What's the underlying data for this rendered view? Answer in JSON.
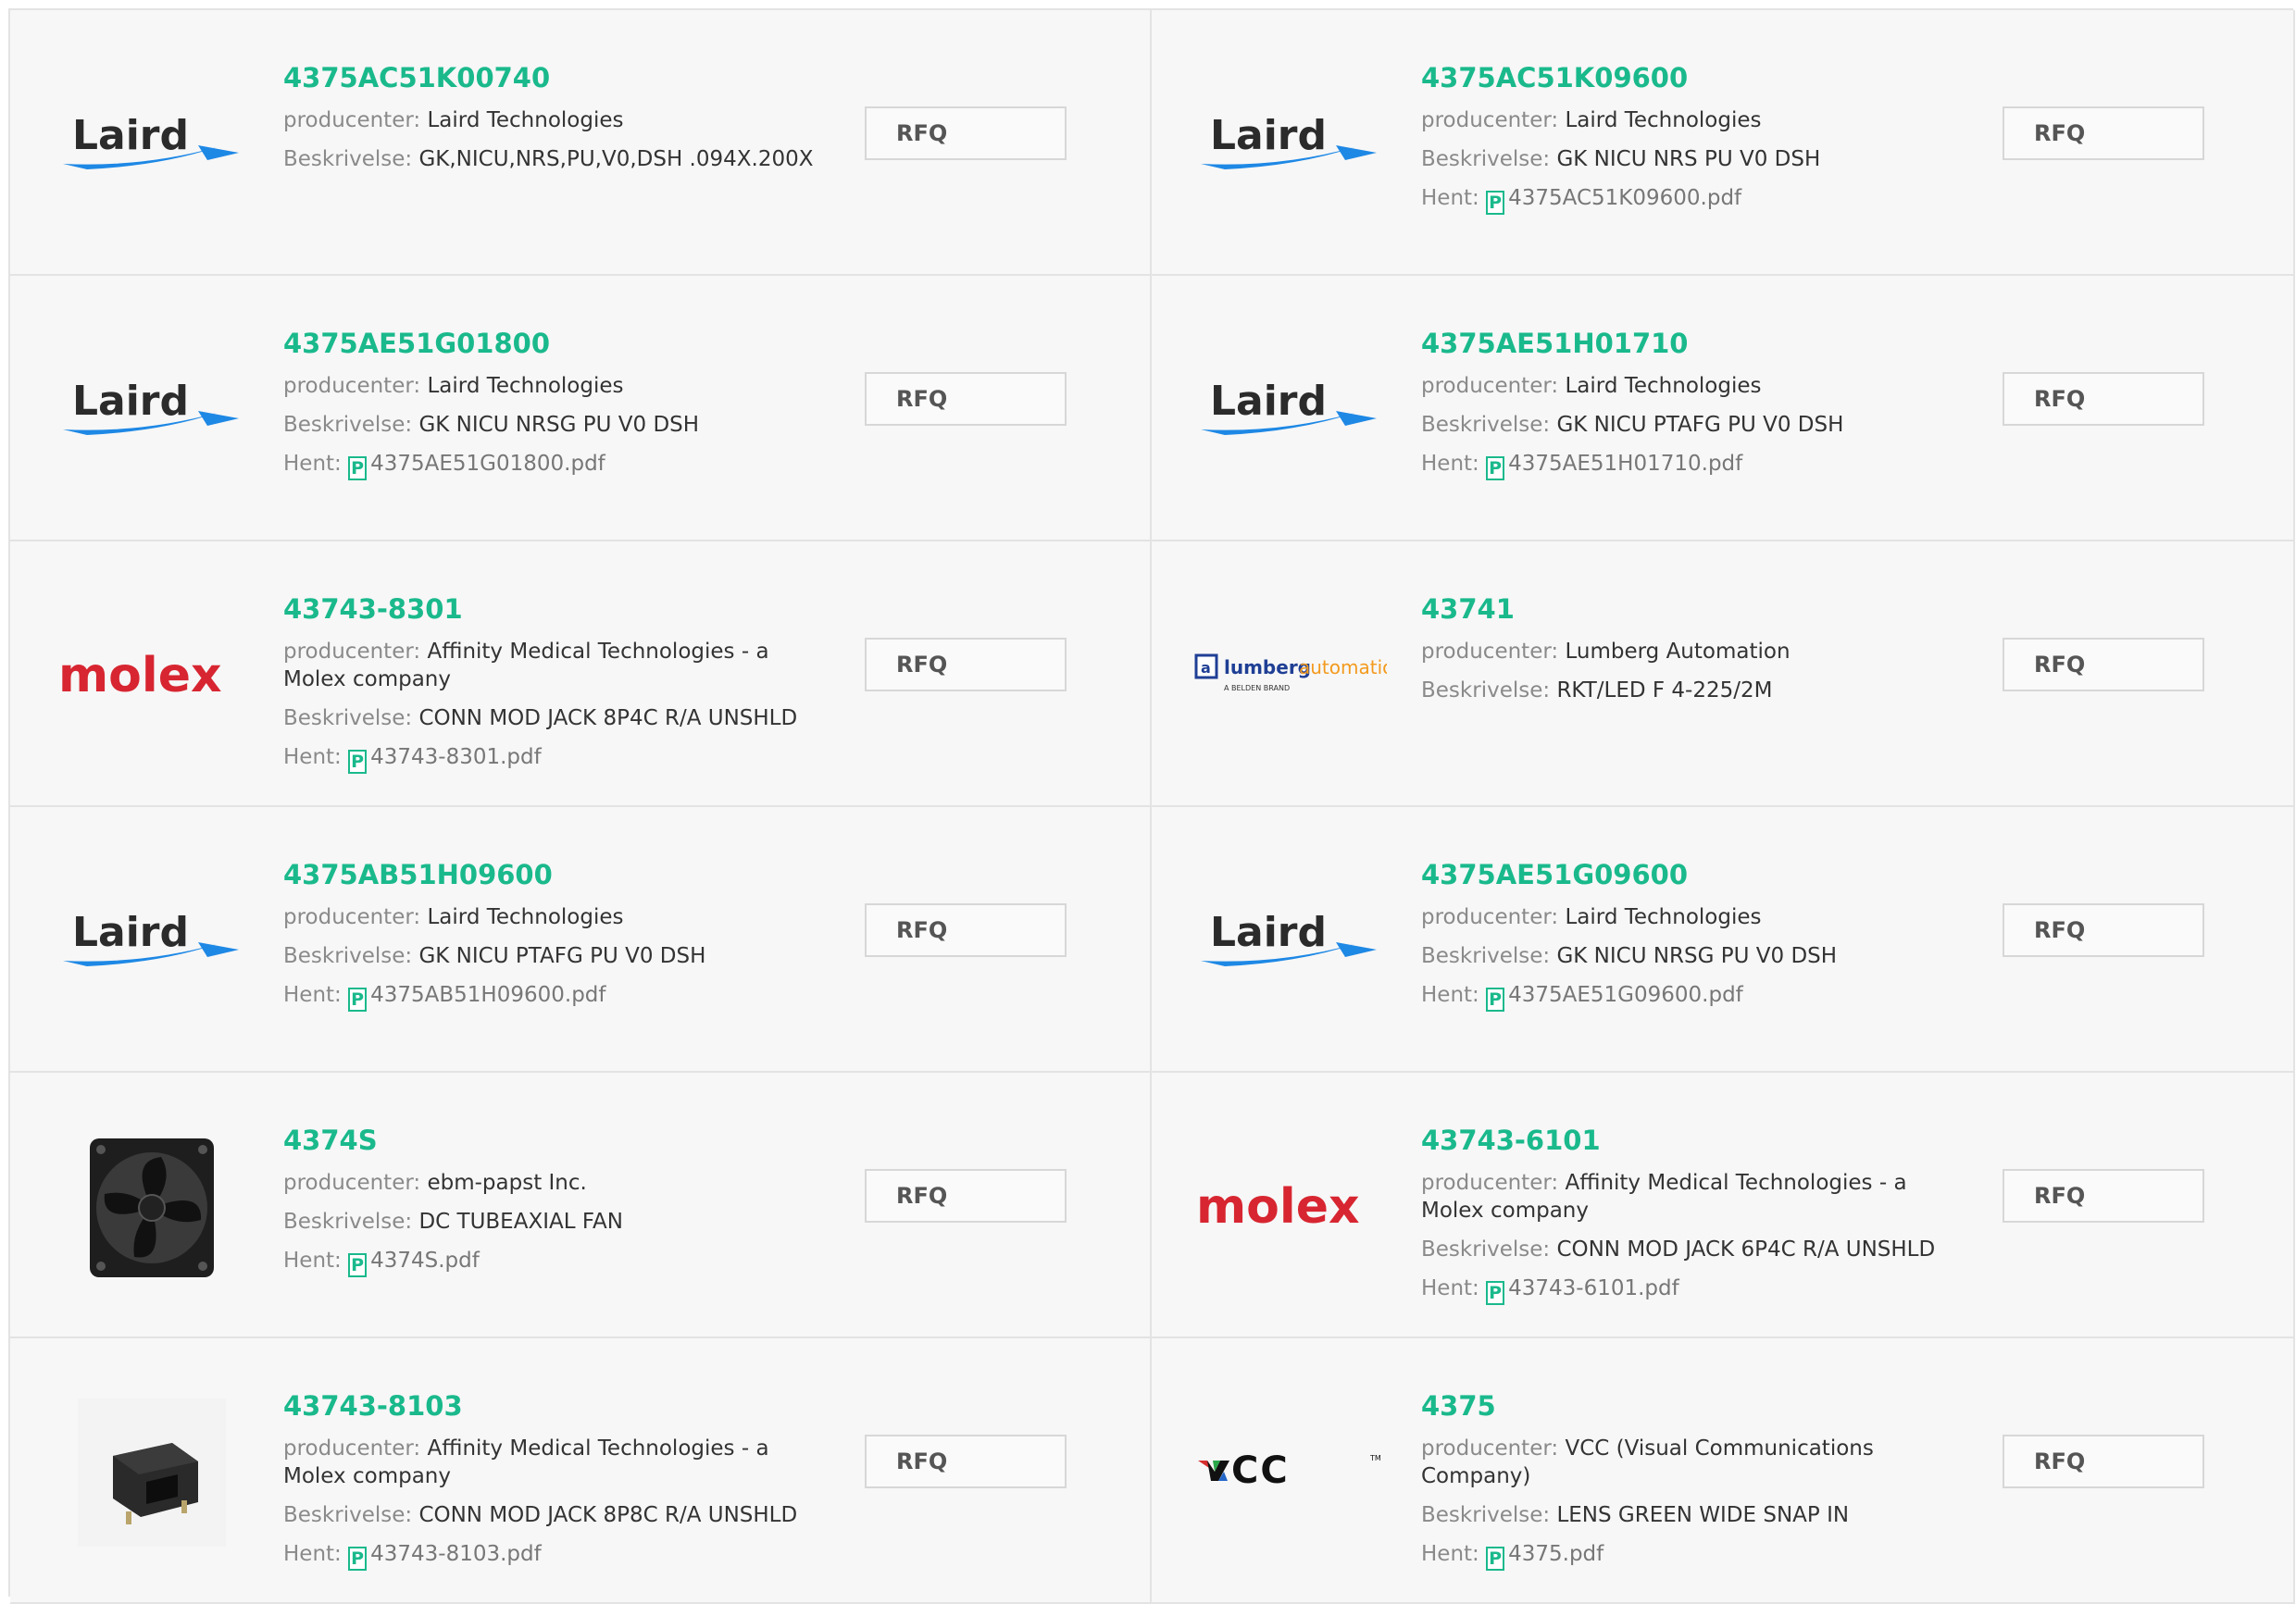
{
  "labels": {
    "manufacturer": "producenter:",
    "description": "Beskrivelse:",
    "download": "Hent:",
    "rfq": "RFQ",
    "pdf_glyph": "P"
  },
  "products": [
    {
      "pn": "4375AC51K00740",
      "manufacturer": "Laird Technologies",
      "description": "GK,NICU,NRS,PU,V0,DSH .094X.200X",
      "pdf": "",
      "logo": "laird"
    },
    {
      "pn": "4375AC51K09600",
      "manufacturer": "Laird Technologies",
      "description": "GK NICU NRS PU V0 DSH",
      "pdf": "4375AC51K09600.pdf",
      "logo": "laird"
    },
    {
      "pn": "4375AE51G01800",
      "manufacturer": "Laird Technologies",
      "description": "GK NICU NRSG PU V0 DSH",
      "pdf": "4375AE51G01800.pdf",
      "logo": "laird"
    },
    {
      "pn": "4375AE51H01710",
      "manufacturer": "Laird Technologies",
      "description": "GK NICU PTAFG PU V0 DSH",
      "pdf": "4375AE51H01710.pdf",
      "logo": "laird"
    },
    {
      "pn": "43743-8301",
      "manufacturer": "Affinity Medical Technologies - a Molex company",
      "description": "CONN MOD JACK 8P4C R/A UNSHLD",
      "pdf": "43743-8301.pdf",
      "logo": "molex"
    },
    {
      "pn": "43741",
      "manufacturer": "Lumberg Automation",
      "description": "RKT/LED F 4-225/2M",
      "pdf": "",
      "logo": "lumberg"
    },
    {
      "pn": "4375AB51H09600",
      "manufacturer": "Laird Technologies",
      "description": "GK NICU PTAFG PU V0 DSH",
      "pdf": "4375AB51H09600.pdf",
      "logo": "laird"
    },
    {
      "pn": "4375AE51G09600",
      "manufacturer": "Laird Technologies",
      "description": "GK NICU NRSG PU V0 DSH",
      "pdf": "4375AE51G09600.pdf",
      "logo": "laird"
    },
    {
      "pn": "4374S",
      "manufacturer": "ebm-papst Inc.",
      "description": "DC TUBEAXIAL FAN",
      "pdf": "4374S.pdf",
      "logo": "fan"
    },
    {
      "pn": "43743-6101",
      "manufacturer": "Affinity Medical Technologies - a Molex company",
      "description": "CONN MOD JACK 6P4C R/A UNSHLD",
      "pdf": "43743-6101.pdf",
      "logo": "molex"
    },
    {
      "pn": "43743-8103",
      "manufacturer": "Affinity Medical Technologies - a Molex company",
      "description": "CONN MOD JACK 8P8C R/A UNSHLD",
      "pdf": "43743-8103.pdf",
      "logo": "jack"
    },
    {
      "pn": "4375",
      "manufacturer": "VCC (Visual Communications Company)",
      "description": "LENS GREEN WIDE SNAP IN",
      "pdf": "4375.pdf",
      "logo": "vcc"
    }
  ],
  "logo_text": {
    "laird": "Laird",
    "molex": "molex",
    "lumberg_main": "lumberg",
    "lumberg_accent": "automation",
    "lumberg_sub": "A BELDEN BRAND",
    "vcc": "VCC",
    "vcc_tm": "TM"
  },
  "colors": {
    "accent": "#1ab98c",
    "laird_swoosh": "#1e88e5",
    "molex_red": "#d72631",
    "lumberg_blue": "#1f3f95",
    "lumberg_orange": "#f39a1e",
    "vcc_red": "#d62e2e",
    "vcc_green": "#2aa84a",
    "vcc_blue": "#2467c8"
  }
}
